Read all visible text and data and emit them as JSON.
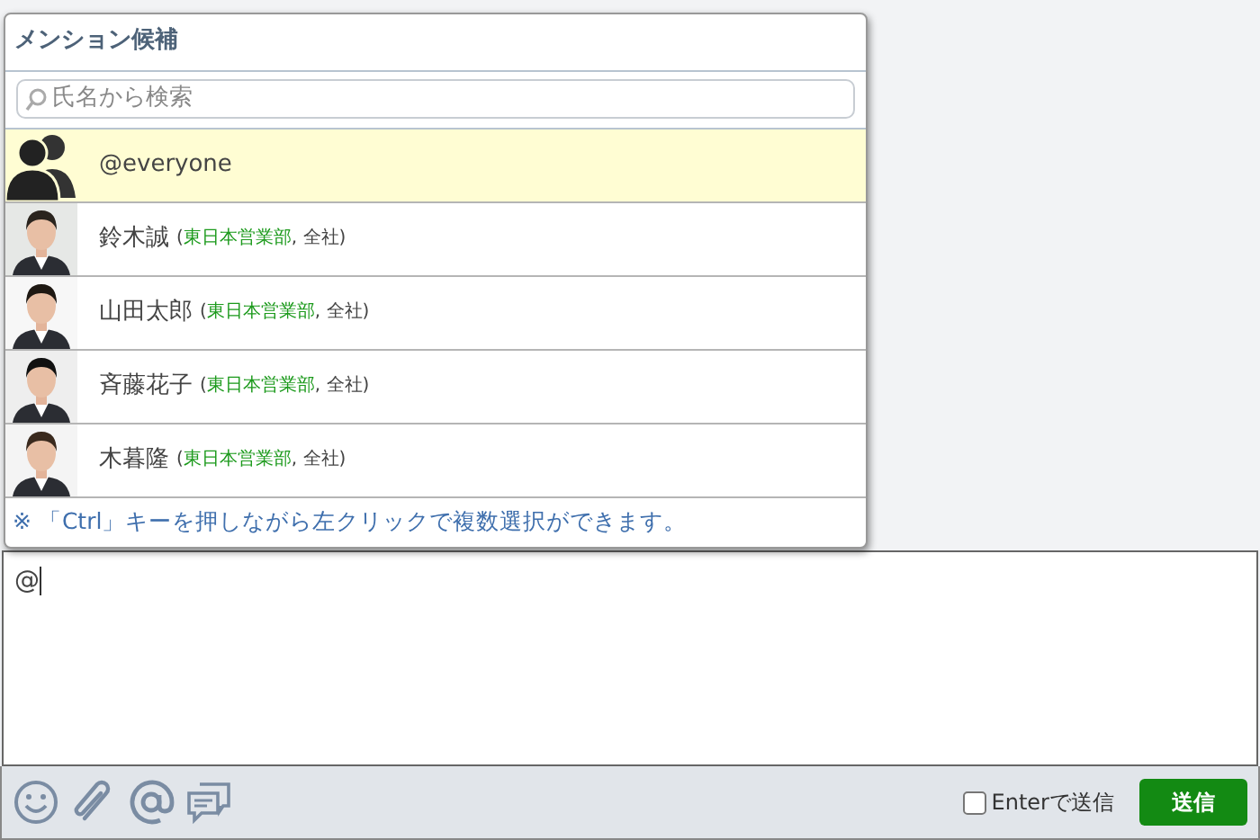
{
  "mention_popup": {
    "title": "メンション候補",
    "search": {
      "placeholder": "氏名から検索"
    },
    "members": [
      {
        "kind": "group",
        "name": "@everyone",
        "selected": true
      },
      {
        "kind": "person",
        "name": "鈴木誠",
        "affiliation": {
          "before": "(",
          "dept": "東日本営業部",
          "after": ", 全社)"
        },
        "selected": false
      },
      {
        "kind": "person",
        "name": "山田太郎",
        "affiliation": {
          "before": "(",
          "dept": "東日本営業部",
          "after": ", 全社)"
        },
        "selected": false
      },
      {
        "kind": "person",
        "name": "斉藤花子",
        "affiliation": {
          "before": "(",
          "dept": "東日本営業部",
          "after": ", 全社)"
        },
        "selected": false
      },
      {
        "kind": "person",
        "name": "木暮隆",
        "affiliation": {
          "before": "(",
          "dept": "東日本営業部",
          "after": ", 全社)"
        },
        "selected": false
      }
    ],
    "note": "※ 「Ctrl」キーを押しながら左クリックで複数選択ができます。"
  },
  "composer": {
    "value": "@"
  },
  "toolbar": {
    "enter_to_send": {
      "label": "Enterで送信",
      "checked": false
    },
    "send_button": "送信"
  }
}
